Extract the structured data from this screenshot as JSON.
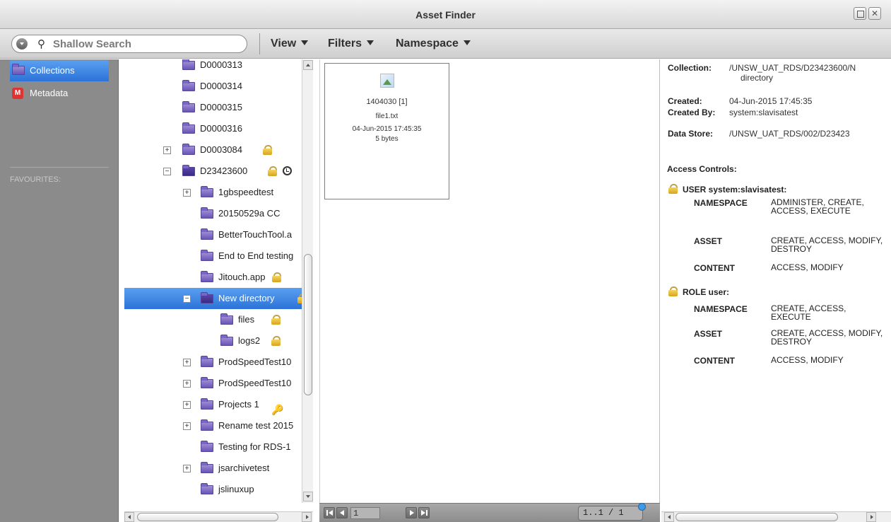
{
  "window": {
    "title": "Asset Finder"
  },
  "toolbar": {
    "search_placeholder": "Shallow Search",
    "menus": [
      "View",
      "Filters",
      "Namespace"
    ]
  },
  "sidebar": {
    "items": [
      {
        "label": "Collections",
        "icon": "folder-icon",
        "active": true
      },
      {
        "label": "Metadata",
        "icon": "metadata-icon",
        "active": false
      }
    ],
    "favourites_label": "FAVOURITES:"
  },
  "tree": {
    "rows": [
      {
        "label": "D0000313"
      },
      {
        "label": "D0000314"
      },
      {
        "label": "D0000315"
      },
      {
        "label": "D0000316"
      },
      {
        "label": "D0003084",
        "lock": true,
        "expander": "+"
      },
      {
        "label": "D23423600",
        "lock": true,
        "clock": true,
        "expander": "−"
      },
      {
        "label": "1gbspeedtest",
        "expander": "+"
      },
      {
        "label": "20150529a CC"
      },
      {
        "label": "BetterTouchTool.a"
      },
      {
        "label": "End to End testing"
      },
      {
        "label": "Jitouch.app",
        "lock": true
      },
      {
        "label": "New directory",
        "lock": true,
        "expander": "−",
        "selected": true
      },
      {
        "label": "files",
        "lock": true
      },
      {
        "label": "logs2",
        "lock": true
      },
      {
        "label": "ProdSpeedTest10",
        "expander": "+"
      },
      {
        "label": "ProdSpeedTest10",
        "expander": "+"
      },
      {
        "label": "Projects 1",
        "key": true,
        "expander": "+"
      },
      {
        "label": "Rename test 2015",
        "expander": "+"
      },
      {
        "label": "Testing for RDS-1"
      },
      {
        "label": "jsarchivetest",
        "expander": "+"
      },
      {
        "label": "jslinuxup"
      },
      {
        "label": "logs2",
        "lock": true
      }
    ]
  },
  "asset": {
    "id": "1404030 [1]",
    "name": "file1.txt",
    "date": "04-Jun-2015 17:45:35",
    "size": "5 bytes"
  },
  "pager": {
    "page": "1",
    "count": "1..1 / 1"
  },
  "details": {
    "collection_label": "Collection:",
    "collection_value": "/UNSW_UAT_RDS/D23423600/N",
    "collection_value2": "directory",
    "created_label": "Created:",
    "created_value": "04-Jun-2015 17:45:35",
    "created_by_label": "Created By:",
    "created_by_value": "system:slavisatest",
    "data_store_label": "Data Store:",
    "data_store_value": "/UNSW_UAT_RDS/002/D23423",
    "access_controls_label": "Access Controls:",
    "acl": [
      {
        "title": "USER system:slavisatest:",
        "perms": [
          {
            "k": "NAMESPACE",
            "v": "ADMINISTER, CREATE, ACCESS, EXECUTE"
          },
          {
            "k": "ASSET",
            "v": "CREATE, ACCESS, MODIFY, DESTROY"
          },
          {
            "k": "CONTENT",
            "v": "ACCESS, MODIFY"
          }
        ]
      },
      {
        "title": "ROLE user:",
        "perms": [
          {
            "k": "NAMESPACE",
            "v": "CREATE, ACCESS, EXECUTE"
          },
          {
            "k": "ASSET",
            "v": "CREATE, ACCESS, MODIFY, DESTROY"
          },
          {
            "k": "CONTENT",
            "v": "ACCESS, MODIFY"
          }
        ]
      }
    ]
  }
}
